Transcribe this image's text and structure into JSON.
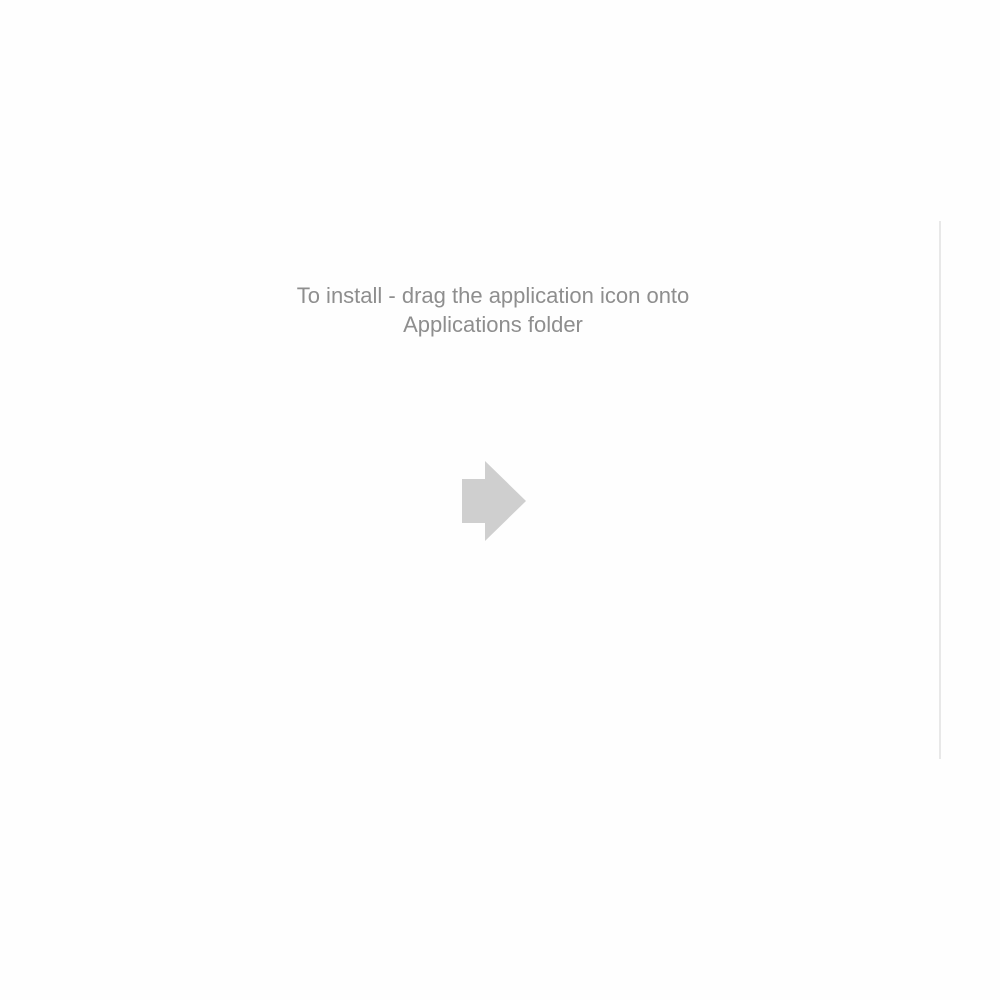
{
  "installer": {
    "instruction_line1": "To install - drag the application icon onto",
    "instruction_line2": "Applications folder",
    "arrow_icon": "right-arrow-icon"
  },
  "colors": {
    "background": "#fefefe",
    "text": "#8e8e8e",
    "arrow": "#cfcfcf",
    "divider": "#e8e8e8"
  }
}
